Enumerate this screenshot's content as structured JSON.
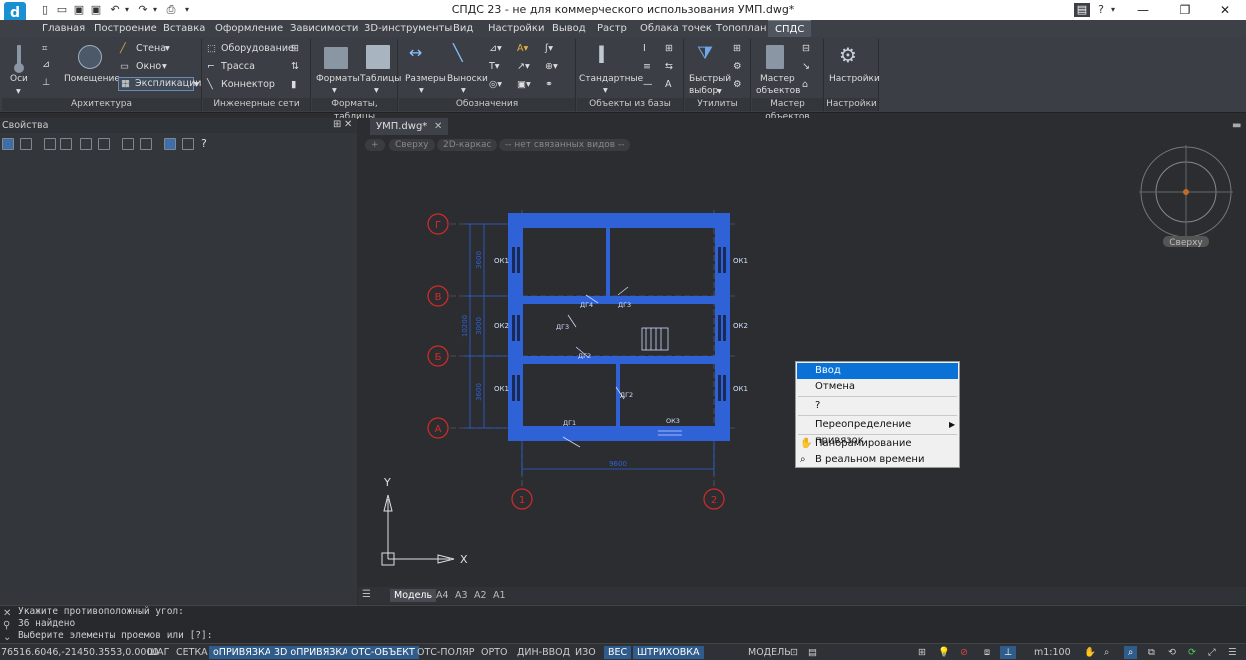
{
  "title": "СПДС 23 - не для коммерческого использования УМП.dwg*",
  "menu_tabs": [
    "Главная",
    "Построение",
    "Вставка",
    "Оформление",
    "Зависимости",
    "3D-инструменты",
    "Вид",
    "Настройки",
    "Вывод",
    "Растр",
    "Облака точек",
    "Топоплан",
    "СПДС"
  ],
  "active_tab": "СПДС",
  "ribbon": {
    "oси": "Оси",
    "pomeshenie": "Помещение",
    "stena": "Стена",
    "okno": "Окно",
    "eksplikacii": "Экспликации",
    "arch_label": "Архитектура",
    "oborud": "Оборудование",
    "trassa": "Трасса",
    "konnektor": "Коннектор",
    "eng_label": "Инженерные сети",
    "formaty": "Форматы",
    "tablicy": "Таблицы",
    "ft_label": "Форматы, таблицы",
    "razmery": "Размеры",
    "vynoski": "Выноски",
    "obozn_label": "Обозначения",
    "standartnye": "Стандартные",
    "obj_label": "Объекты из базы",
    "bystryi1": "Быстрый",
    "bystryi2": "выбор",
    "util_label": "Утилиты",
    "master1": "Мастер",
    "master2": "объектов",
    "master_label": "Мастер объектов",
    "nastroiki": "Настройки",
    "nastr_label": "Настройки"
  },
  "panel_title": "Свойства",
  "doc_tab": "УМП.dwg*",
  "viewport_controls": [
    "+",
    "Сверху",
    "2D-каркас",
    "-- нет связанных видов --"
  ],
  "viewcube_label": "Сверху",
  "drawing": {
    "axes_rows": [
      "Г",
      "В",
      "Б",
      "А"
    ],
    "axes_cols": [
      "1",
      "2"
    ],
    "dims_v": [
      "3600",
      "3000",
      "3600"
    ],
    "dim_total_v": "10200",
    "dim_h": "9600",
    "windows": [
      "ОК1",
      "ОК2",
      "ОК1",
      "ОК1",
      "ОК2",
      "ОК1"
    ],
    "doors": [
      "ДГ4",
      "ДГ3",
      "ДГ3",
      "ДГ2",
      "ДГ2",
      "ДГ1",
      "ОК3"
    ],
    "axis_y": "Y",
    "axis_x": "X"
  },
  "context_menu": [
    "Ввод",
    "Отмена",
    "?",
    "Переопределение привязок",
    "Панорамирование",
    "В реальном времени"
  ],
  "layout_tabs": [
    "Модель",
    "А4",
    "А3",
    "А2",
    "А1"
  ],
  "command_lines": [
    "Укажите противоположный угол:",
    "36 найдено",
    "Выберите элементы проемов или [?]:"
  ],
  "coords": "76516.6046,-21450.3553,0.0000",
  "status_items": [
    {
      "label": "ШАГ",
      "on": false
    },
    {
      "label": "СЕТКА",
      "on": false
    },
    {
      "label": "оПРИВЯЗКА",
      "on": true
    },
    {
      "label": "3D оПРИВЯЗКА",
      "on": true
    },
    {
      "label": "ОТС-ОБЪЕКТ",
      "on": true
    },
    {
      "label": "ОТС-ПОЛЯР",
      "on": false
    },
    {
      "label": "ОРТО",
      "on": false
    },
    {
      "label": "ДИН-ВВОД",
      "on": false
    },
    {
      "label": "ИЗО",
      "on": false
    },
    {
      "label": "ВЕС",
      "on": true
    },
    {
      "label": "ШТРИХОВКА",
      "on": true
    }
  ],
  "model_label": "МОДЕЛЬ",
  "scale": "m1:100",
  "colors": {
    "accent": "#2f5c8a",
    "wall": "#2e62d6",
    "axis": "#d42b2b",
    "menu_sel": "#0a72d6"
  }
}
